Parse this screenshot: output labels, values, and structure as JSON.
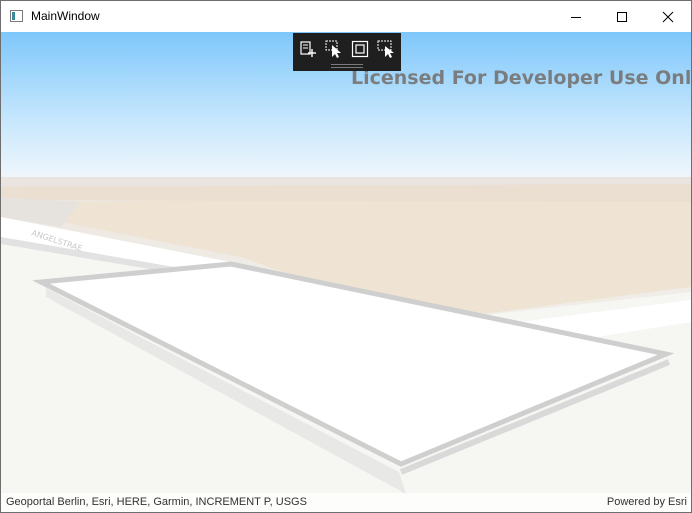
{
  "window": {
    "title": "MainWindow",
    "controls": {
      "minimize": "minimize-icon",
      "maximize": "maximize-icon",
      "close": "close-icon"
    }
  },
  "map": {
    "watermark": "Licensed For Developer Use Only",
    "street_label": "ANGELSTRAE",
    "attribution": "Geoportal Berlin, Esri, HERE, Garmin, INCREMENT P, USGS",
    "powered_by": "Powered by Esri",
    "colors": {
      "sky_top": "#7ec7fb",
      "sky_bottom": "#ffffff",
      "ground_beige": "#efe4d3",
      "ground_light": "#f5f5f2",
      "outline": "#c9c9c9"
    }
  },
  "toolbar": {
    "tools": [
      {
        "icon": "add-edit-icon"
      },
      {
        "icon": "select-cursor-icon"
      },
      {
        "icon": "frame-select-icon"
      },
      {
        "icon": "lasso-select-icon"
      }
    ]
  }
}
